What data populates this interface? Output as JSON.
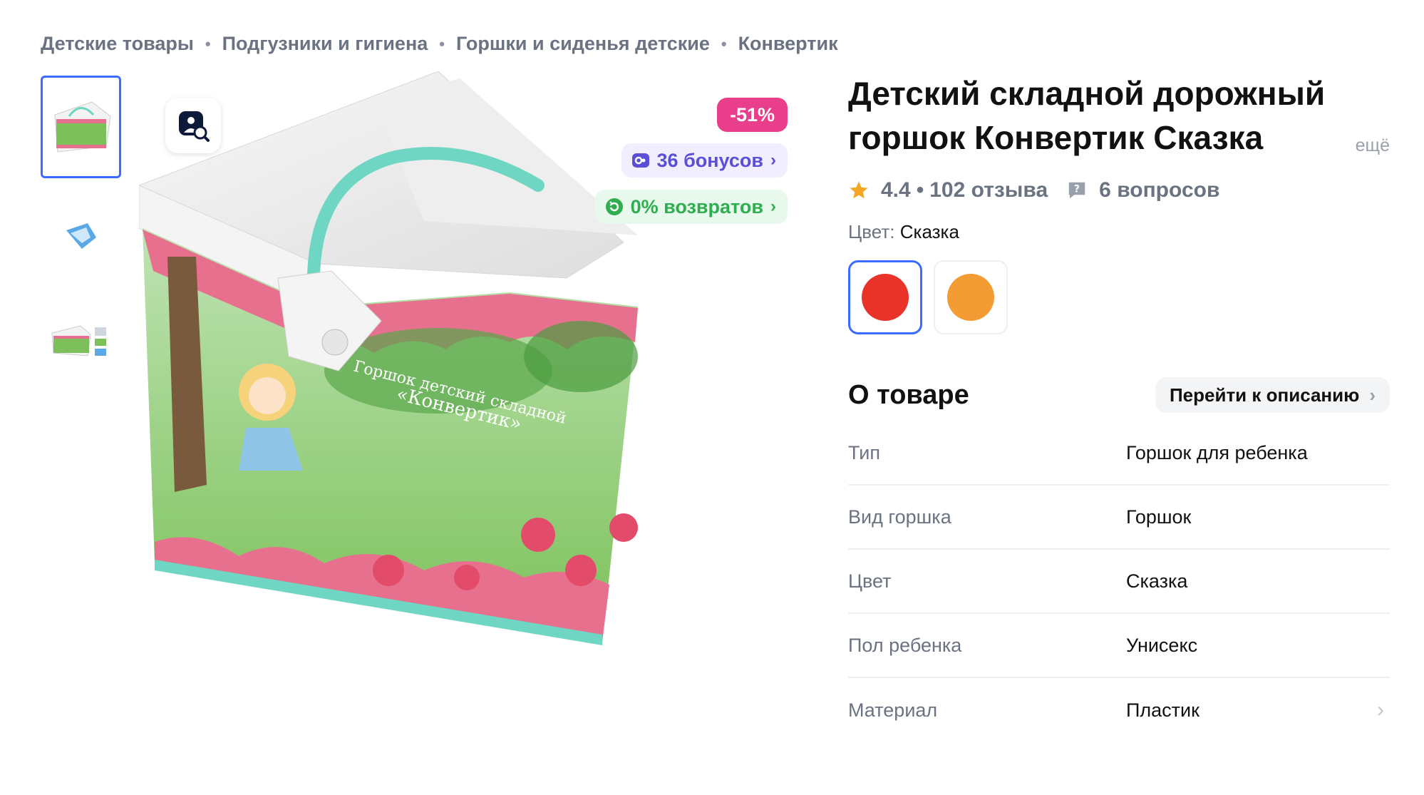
{
  "breadcrumb": {
    "items": [
      "Детские товары",
      "Подгузники и гигиена",
      "Горшки и сиденья детские",
      "Конвертик"
    ],
    "separator": "•"
  },
  "gallery": {
    "thumbnails": [
      "product-photo-main",
      "product-photo-blue-variant",
      "product-photo-set"
    ],
    "active_index": 0
  },
  "badges": {
    "discount": "-51%",
    "bonus": "36 бонусов",
    "returns": "0% возвратов"
  },
  "product": {
    "title": "Детский складной дорожный горшок Конвертик Сказка",
    "more_link": "ещё",
    "rating": "4.4",
    "rating_separator": "•",
    "reviews": "102 отзыва",
    "questions": "6 вопросов",
    "color_label": "Цвет:",
    "color_value": "Сказка",
    "swatches": [
      {
        "name": "red",
        "color": "#e8322a"
      },
      {
        "name": "orange",
        "color": "#f39c34"
      }
    ],
    "selected_swatch": 0
  },
  "about": {
    "title": "О товаре",
    "goto_label": "Перейти к описанию",
    "specs": [
      {
        "key": "Тип",
        "value": "Горшок для ребенка"
      },
      {
        "key": "Вид горшка",
        "value": "Горшок"
      },
      {
        "key": "Цвет",
        "value": "Сказка"
      },
      {
        "key": "Пол ребенка",
        "value": "Унисекс"
      },
      {
        "key": "Материал",
        "value": "Пластик"
      }
    ]
  },
  "colors": {
    "accent": "#3b6bff",
    "discount": "#e83e8c",
    "bonus": "#5a4fd6",
    "returns": "#2fae4f",
    "muted": "#6b7282",
    "star": "#f5a623"
  },
  "icons": {
    "search_photo": "image-search-icon",
    "bonus": "bonus-icon",
    "returns": "returns-icon",
    "star": "star-icon",
    "question": "question-icon",
    "chevron": "chevron-right-icon"
  }
}
